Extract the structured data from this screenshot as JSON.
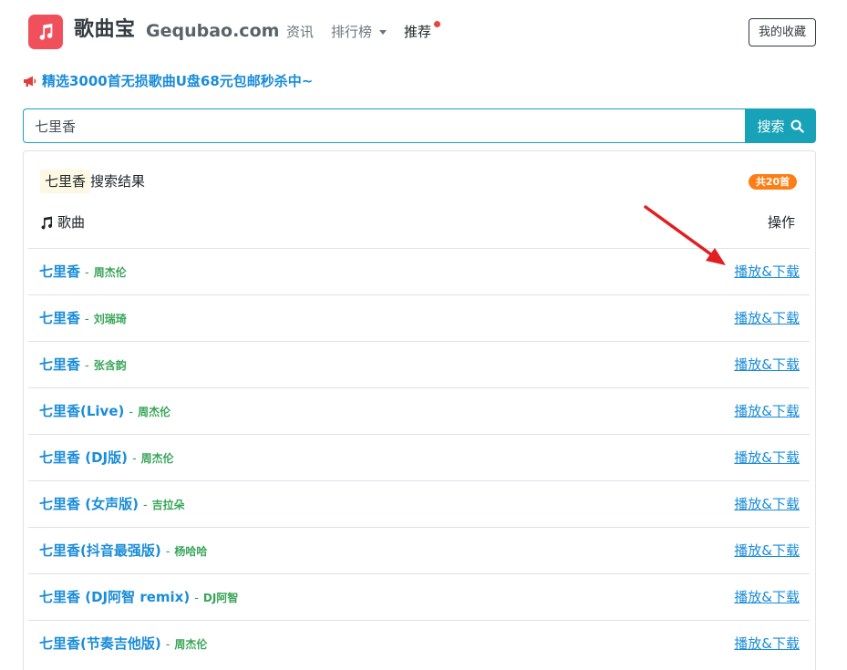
{
  "header": {
    "brand": "歌曲宝",
    "domain": "Gequbao.com",
    "nav": [
      {
        "label": "资讯"
      },
      {
        "label": "排行榜"
      },
      {
        "label": "推荐"
      }
    ],
    "favorites_label": "我的收藏",
    "logo_icon": "music-note-icon",
    "accent_color": "#f0505c"
  },
  "announcement": {
    "text": "精选3000首无损歌曲U盘68元包邮秒杀中~",
    "icon": "megaphone-icon",
    "color": "#1a8cd8"
  },
  "search": {
    "value": "七里香",
    "button_label": "搜索",
    "button_icon": "search-icon",
    "accent_color": "#17a2b8"
  },
  "results": {
    "keyword": "七里香",
    "title_suffix": "搜索结果",
    "count_badge": "共20首",
    "col_song": "歌曲",
    "col_action": "操作",
    "items": [
      {
        "title": "七里香",
        "artist": "周杰伦",
        "action": "播放&下载"
      },
      {
        "title": "七里香",
        "artist": "刘瑞琦",
        "action": "播放&下载"
      },
      {
        "title": "七里香",
        "artist": "张含韵",
        "action": "播放&下载"
      },
      {
        "title": "七里香(Live)",
        "artist": "周杰伦",
        "action": "播放&下载"
      },
      {
        "title": "七里香 (DJ版)",
        "artist": "周杰伦",
        "action": "播放&下载"
      },
      {
        "title": "七里香 (女声版)",
        "artist": "吉拉朵",
        "action": "播放&下载"
      },
      {
        "title": "七里香(抖音最强版)",
        "artist": "杨哈哈",
        "action": "播放&下载"
      },
      {
        "title": "七里香 (DJ阿智 remix)",
        "artist": "DJ阿智",
        "action": "播放&下载"
      },
      {
        "title": "七里香(节奏吉他版)",
        "artist": "周杰伦",
        "action": "播放&下载"
      }
    ]
  }
}
